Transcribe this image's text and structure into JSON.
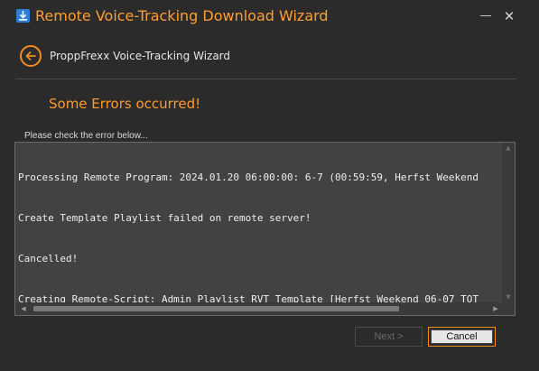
{
  "window": {
    "title": "Remote Voice-Tracking Download Wizard",
    "minimize_glyph": "—",
    "close_glyph": "✕",
    "icon": "download-app-icon"
  },
  "wizard": {
    "back_icon": "back-arrow-icon",
    "title": "ProppFrexx Voice-Tracking Wizard",
    "error_heading": "Some Errors occurred!",
    "check_label": "Please check the error below...",
    "log_lines": [
      "Processing Remote Program: 2024.01.20 06:00:00: 6-7 (00:59:59, Herfst Weekend",
      "Create Template Playlist failed on remote server!",
      "Cancelled!",
      "Creating Remote-Script: Admin_Playlist RVT Template [Herfst Weekend 06-07 TOT"
    ]
  },
  "buttons": {
    "next_label": "Next >",
    "cancel_label": "Cancel"
  },
  "colors": {
    "accent": "#ff9e2c",
    "background": "#2b2b2b",
    "log_background": "#424242"
  }
}
